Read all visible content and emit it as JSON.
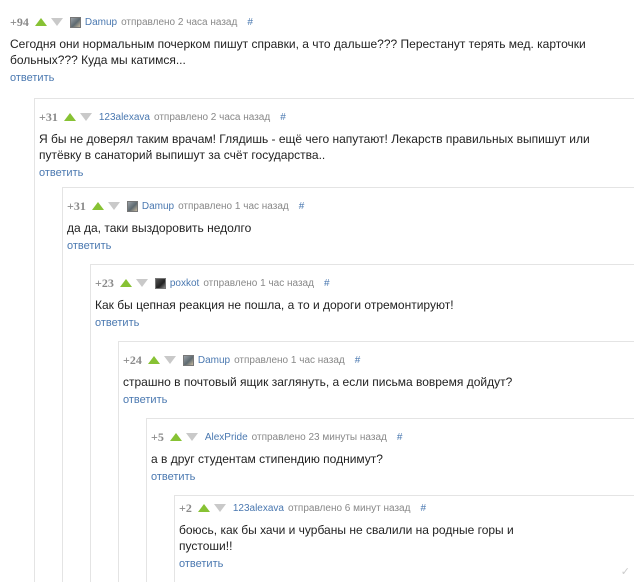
{
  "reply_label": "ответить",
  "permalink_symbol": "#",
  "icons": {
    "upvote": "upvote-arrow-icon",
    "downvote": "downvote-arrow-icon",
    "avatar": "user-avatar-icon"
  },
  "colors": {
    "upvote": "#87c234",
    "downvote": "#c9c9c9",
    "link": "#4a78b0",
    "score": "#8a8a8a"
  },
  "comments": [
    {
      "score": "+94",
      "author": "Damup",
      "posted": "отправлено 2 часа назад",
      "text": "Сегодня они нормальным почерком пишут справки, а что дальше??? Перестанут терять мед. карточки больных??? Куда мы катимся..."
    },
    {
      "score": "+31",
      "author": "123alexava",
      "posted": "отправлено 2 часа назад",
      "text": "Я бы не доверял таким врачам! Глядишь - ещё чего напутают! Лекарств правильных выпишут или путёвку в санаторий выпишут за счёт государства.."
    },
    {
      "score": "+31",
      "author": "Damup",
      "posted": "отправлено 1 час назад",
      "text": "да да, таки выздоровить недолго"
    },
    {
      "score": "+23",
      "author": "poxkot",
      "posted": "отправлено 1 час назад",
      "text": "Как бы цепная реакция не пошла, а то и дороги отремонтируют!"
    },
    {
      "score": "+24",
      "author": "Damup",
      "posted": "отправлено 1 час назад",
      "text": "страшно в почтовый ящик заглянуть, а если письма вовремя дойдут?"
    },
    {
      "score": "+5",
      "author": "AlexPride",
      "posted": "отправлено 23 минуты назад",
      "text": "а в друг студентам стипендию поднимут?"
    },
    {
      "score": "+2",
      "author": "123alexava",
      "posted": "отправлено 6 минут назад",
      "text": "боюсь, как бы хачи и чурбаны не свалили на родные горы и пустоши!!"
    }
  ]
}
